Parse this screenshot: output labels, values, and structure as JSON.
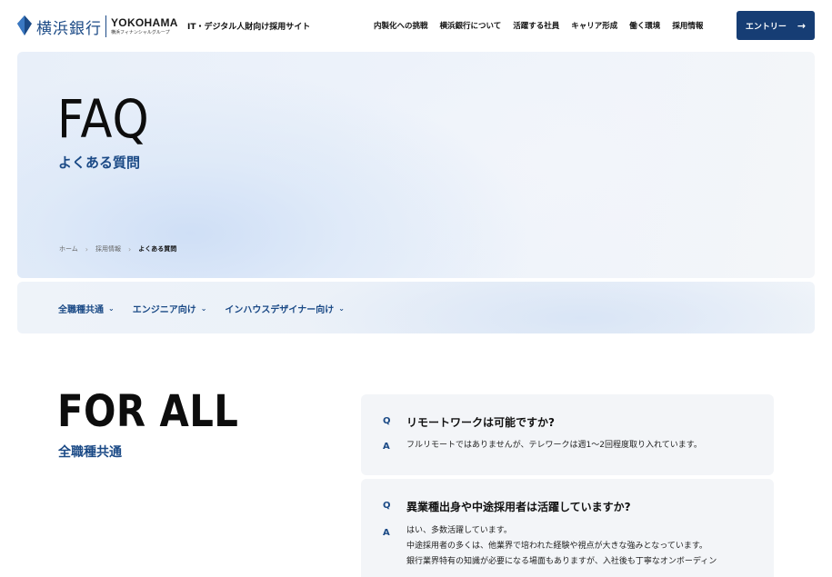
{
  "header": {
    "logo_jp": "横浜銀行",
    "logo_en": "YOKOHAMA",
    "logo_sub": "横浜フィナンシャルグループ",
    "site_label": "IT・デジタル人財向け採用サイト",
    "nav": [
      {
        "label": "内製化への挑戦"
      },
      {
        "label": "横浜銀行について"
      },
      {
        "label": "活躍する社員"
      },
      {
        "label": "キャリア形成"
      },
      {
        "label": "働く環境"
      },
      {
        "label": "採用情報"
      }
    ],
    "entry_label": "エントリー",
    "entry_icon": "arrow-right-icon",
    "brand_color": "#163d74"
  },
  "hero": {
    "title": "FAQ",
    "subtitle": "よくある質問",
    "breadcrumb": [
      "ホーム",
      "採用情報",
      "よくある質問"
    ]
  },
  "tabs": [
    {
      "label": "全職種共通"
    },
    {
      "label": "エンジニア向け"
    },
    {
      "label": "インハウスデザイナー向け"
    }
  ],
  "section": {
    "title": "FOR ALL",
    "subtitle": "全職種共通",
    "faqs": [
      {
        "q_mark": "Q",
        "question": "リモートワークは可能ですか?",
        "a_mark": "A",
        "answer_lines": [
          "フルリモートではありませんが、テレワークは週1〜2回程度取り入れています。"
        ]
      },
      {
        "q_mark": "Q",
        "question": "異業種出身や中途採用者は活躍していますか?",
        "a_mark": "A",
        "answer_lines": [
          "はい、多数活躍しています。",
          "中途採用者の多くは、他業界で培われた経験や視点が大きな強みとなっています。",
          "銀行業界特有の知識が必要になる場面もありますが、入社後も丁寧なオンボーディン"
        ]
      }
    ]
  }
}
